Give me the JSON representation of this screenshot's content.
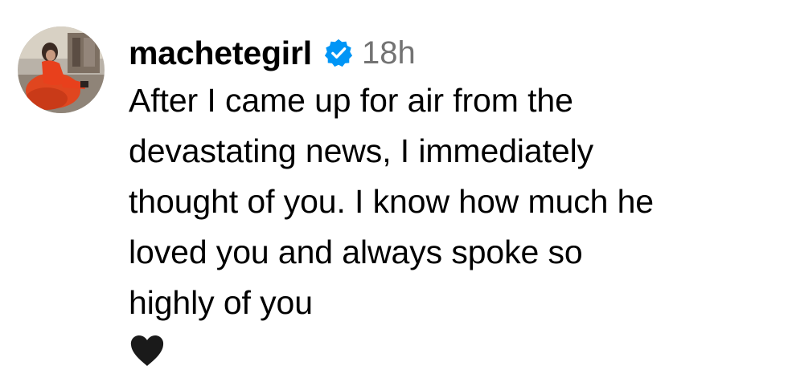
{
  "comment": {
    "username": "machetegirl",
    "verified_icon": "verified-badge-icon",
    "timestamp": "18h",
    "text_lines": [
      "After I came up for air from the",
      "devastating news, I immediately",
      "thought of you. I know how much he",
      "loved you and always spoke so",
      "highly of you"
    ],
    "emoji": "black-heart-icon"
  },
  "colors": {
    "verified_blue": "#0095F6",
    "timestamp_gray": "#737373",
    "text": "#000000"
  }
}
